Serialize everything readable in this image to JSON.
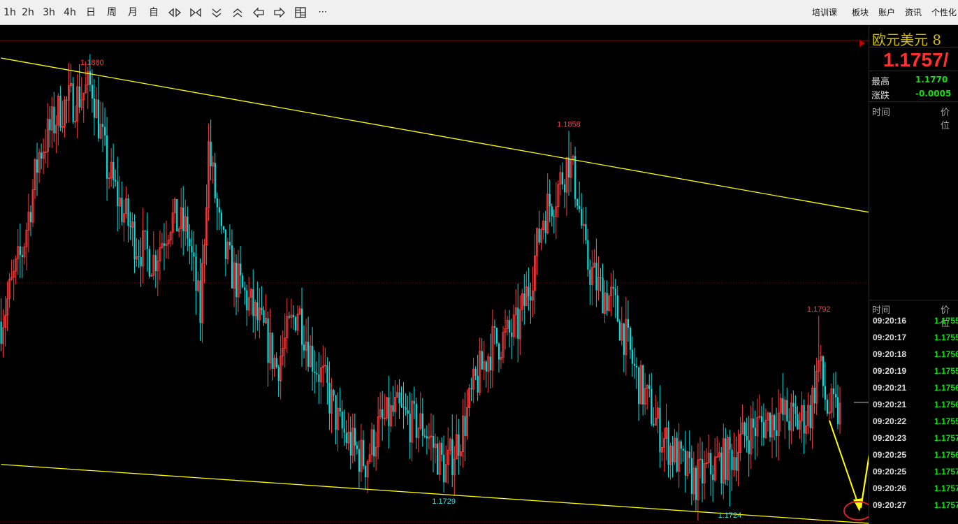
{
  "toolbar": {
    "periods": [
      "1h",
      "2h",
      "3h",
      "4h",
      "日",
      "周",
      "月",
      "自"
    ],
    "links": [
      "培训课",
      "板块",
      "账户",
      "资讯",
      "个性化"
    ]
  },
  "quote": {
    "name": "欧元美元",
    "name_suffix": "8",
    "price": "1.1757/",
    "high_label": "最高",
    "high_value": "1.1770",
    "change_label": "涨跌",
    "change_value": "-0.0005",
    "time_header": "时间",
    "price_header": "价位"
  },
  "ticks": {
    "time_header": "时间",
    "price_header": "价位",
    "rows": [
      {
        "time": "09:20:16",
        "price": "1.1755"
      },
      {
        "time": "09:20:17",
        "price": "1.1755"
      },
      {
        "time": "09:20:18",
        "price": "1.1756"
      },
      {
        "time": "09:20:19",
        "price": "1.1755"
      },
      {
        "time": "09:20:21",
        "price": "1.1756"
      },
      {
        "time": "09:20:21",
        "price": "1.1756"
      },
      {
        "time": "09:20:22",
        "price": "1.1755"
      },
      {
        "time": "09:20:23",
        "price": "1.1757"
      },
      {
        "time": "09:20:25",
        "price": "1.1756"
      },
      {
        "time": "09:20:25",
        "price": "1.1757"
      },
      {
        "time": "09:20:26",
        "price": "1.1757"
      },
      {
        "time": "09:20:27",
        "price": "1.1757"
      }
    ]
  },
  "chart_data": {
    "type": "candlestick",
    "y_range": [
      1.1718,
      1.189
    ],
    "annotations": [
      {
        "label": "1.1880",
        "value": 1.188,
        "kind": "high",
        "index": 43
      },
      {
        "label": "1.1858",
        "value": 1.1858,
        "kind": "high",
        "index": 268
      },
      {
        "label": "1.1729",
        "value": 1.1729,
        "kind": "low",
        "index": 209
      },
      {
        "label": "1.1724",
        "value": 1.1724,
        "kind": "low",
        "index": 344
      },
      {
        "label": "1.1792",
        "value": 1.1792,
        "kind": "high",
        "index": 386
      }
    ],
    "anchors": [
      [
        0,
        1.179
      ],
      [
        10,
        1.1815
      ],
      [
        18,
        1.185
      ],
      [
        28,
        1.1866
      ],
      [
        36,
        1.187
      ],
      [
        43,
        1.1874
      ],
      [
        50,
        1.1845
      ],
      [
        56,
        1.1832
      ],
      [
        64,
        1.1818
      ],
      [
        72,
        1.1812
      ],
      [
        80,
        1.1827
      ],
      [
        88,
        1.1822
      ],
      [
        94,
        1.1792
      ],
      [
        98,
        1.1852
      ],
      [
        104,
        1.1818
      ],
      [
        110,
        1.1806
      ],
      [
        116,
        1.1798
      ],
      [
        124,
        1.1786
      ],
      [
        130,
        1.1774
      ],
      [
        140,
        1.1795
      ],
      [
        146,
        1.1779
      ],
      [
        152,
        1.1769
      ],
      [
        160,
        1.1752
      ],
      [
        166,
        1.1745
      ],
      [
        172,
        1.174
      ],
      [
        178,
        1.1752
      ],
      [
        186,
        1.1758
      ],
      [
        194,
        1.1754
      ],
      [
        200,
        1.1752
      ],
      [
        205,
        1.1744
      ],
      [
        210,
        1.1737
      ],
      [
        218,
        1.1752
      ],
      [
        224,
        1.1768
      ],
      [
        232,
        1.1782
      ],
      [
        238,
        1.1784
      ],
      [
        244,
        1.1788
      ],
      [
        250,
        1.1805
      ],
      [
        256,
        1.1828
      ],
      [
        262,
        1.1836
      ],
      [
        268,
        1.1848
      ],
      [
        272,
        1.1836
      ],
      [
        276,
        1.1812
      ],
      [
        282,
        1.1802
      ],
      [
        288,
        1.1798
      ],
      [
        294,
        1.1786
      ],
      [
        300,
        1.177
      ],
      [
        306,
        1.176
      ],
      [
        312,
        1.1749
      ],
      [
        318,
        1.1743
      ],
      [
        322,
        1.1738
      ],
      [
        328,
        1.1733
      ],
      [
        334,
        1.1737
      ],
      [
        340,
        1.174
      ],
      [
        346,
        1.1743
      ],
      [
        352,
        1.175
      ],
      [
        360,
        1.1754
      ],
      [
        368,
        1.1757
      ],
      [
        376,
        1.1754
      ],
      [
        382,
        1.1758
      ],
      [
        386,
        1.1775
      ],
      [
        390,
        1.1759
      ],
      [
        396,
        1.1757
      ]
    ],
    "channel": {
      "upper": [
        [
          0,
          1.1884
        ],
        [
          410,
          1.1829
        ]
      ],
      "lower": [
        [
          0,
          1.1739
        ],
        [
          410,
          1.1718
        ]
      ]
    },
    "colors": {
      "up": "#ff3b3b",
      "down": "#00e0e0",
      "channel": "#ffff00",
      "arrow": "#ffff00",
      "circle": "#e02020"
    }
  }
}
